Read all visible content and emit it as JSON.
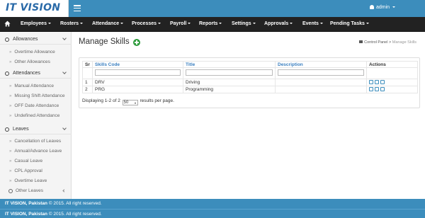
{
  "brand": "IT VISION",
  "user": {
    "name": "admin"
  },
  "nav": [
    {
      "label": "Employees"
    },
    {
      "label": "Rosters"
    },
    {
      "label": "Attendance"
    },
    {
      "label": "Processes"
    },
    {
      "label": "Payroll"
    },
    {
      "label": "Reports"
    },
    {
      "label": "Settings"
    },
    {
      "label": "Approvals"
    },
    {
      "label": "Events"
    },
    {
      "label": "Pending Tasks"
    }
  ],
  "sidebar": {
    "allowances": {
      "title": "Allowances",
      "items": [
        "Overtime Allowance",
        "Other Allowances"
      ]
    },
    "attendances": {
      "title": "Attendances",
      "items": [
        "Manual Attendance",
        "Missing Shift Attendance",
        "OFF Date Attendance",
        "Undefined Attendance"
      ]
    },
    "leaves": {
      "title": "Leaves",
      "items": [
        "Cancellation of Leaves",
        "Annual/Advance Leave",
        "Casual Leave",
        "CPL Approval",
        "Overtime Leave"
      ]
    },
    "other_leaves": "Other Leaves"
  },
  "page": {
    "title": "Manage Skills",
    "breadcrumb": {
      "home": "Control Panel",
      "current": "Manage Skills"
    }
  },
  "table": {
    "headers": {
      "sr": "Sr",
      "code": "Skills Code",
      "title": "Title",
      "description": "Description",
      "actions": "Actions"
    },
    "rows": [
      {
        "sr": "1",
        "code": "DRV",
        "title": "Driving",
        "description": ""
      },
      {
        "sr": "2",
        "code": "PRG",
        "title": "Programming",
        "description": ""
      }
    ]
  },
  "pager": {
    "prefix": "Displaying 1-2 of 2",
    "per_page": "50",
    "suffix": "results per page."
  },
  "footer": {
    "line1": {
      "bold": "IT VISION, Pakistan",
      "rest": " © 2015. All right reserved."
    },
    "line2": {
      "bold": "IT VISION, Pakistan",
      "rest": " © 2015. All right reserved."
    }
  }
}
